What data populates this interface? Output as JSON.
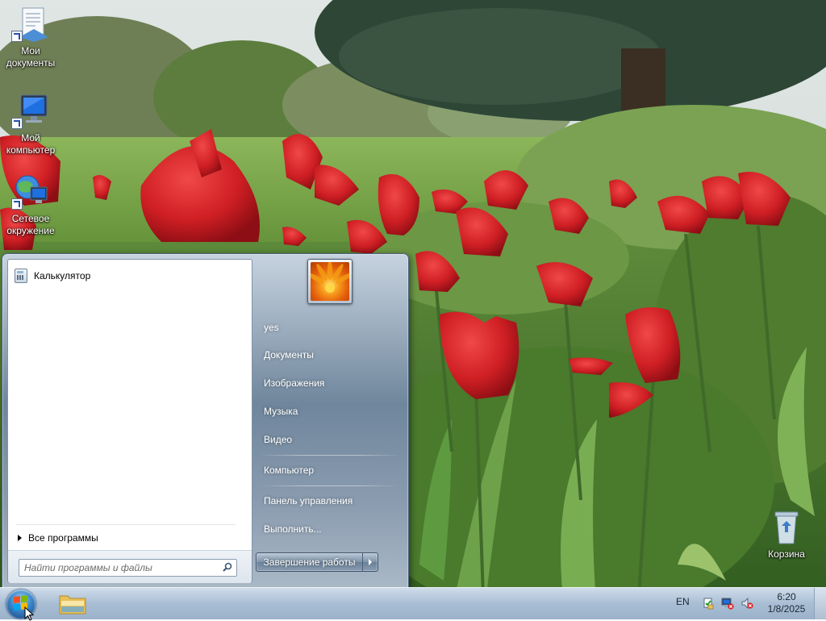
{
  "desktop": {
    "icons": [
      {
        "label": "Мои документы",
        "icon": "my-documents-icon"
      },
      {
        "label": "Мой компьютер",
        "icon": "my-computer-icon"
      },
      {
        "label": "Сетевое окружение",
        "icon": "network-icon"
      },
      {
        "label": "Корзина",
        "icon": "recycle-bin-icon"
      }
    ]
  },
  "start_menu": {
    "pinned": [
      {
        "label": "Калькулятор",
        "icon": "calculator-icon"
      }
    ],
    "all_programs_label": "Все программы",
    "search": {
      "placeholder": "Найти программы и файлы",
      "value": ""
    },
    "right_items": [
      {
        "label": "yes"
      },
      {
        "label": "Документы"
      },
      {
        "label": "Изображения"
      },
      {
        "label": "Музыка"
      },
      {
        "label": "Видео"
      },
      {
        "label": "Компьютер"
      },
      {
        "label": "Панель управления"
      },
      {
        "label": "Выполнить..."
      }
    ],
    "shutdown_label": "Завершение работы"
  },
  "taskbar": {
    "language": "EN",
    "clock": {
      "time": "6:20",
      "date": "1/8/2025"
    },
    "tray_icons": [
      "action-center-icon",
      "network-disconnected-icon",
      "volume-muted-icon"
    ]
  },
  "colors": {
    "taskbar": "#a9bed4",
    "start_menu_right": "#6f869c",
    "accent": "#3a86c9"
  }
}
